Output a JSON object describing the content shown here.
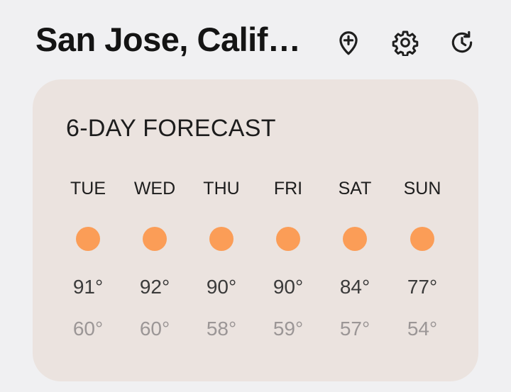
{
  "header": {
    "location": "San Jose, Calif…",
    "actions": [
      {
        "icon": "add-location-icon"
      },
      {
        "icon": "gear-icon"
      },
      {
        "icon": "history-icon"
      }
    ]
  },
  "forecast": {
    "title": "6-DAY FORECAST",
    "days": [
      {
        "name": "TUE",
        "high": "91°",
        "low": "60°",
        "icon": "sun-icon"
      },
      {
        "name": "WED",
        "high": "92°",
        "low": "60°",
        "icon": "sun-icon"
      },
      {
        "name": "THU",
        "high": "90°",
        "low": "58°",
        "icon": "sun-icon"
      },
      {
        "name": "FRI",
        "high": "90°",
        "low": "59°",
        "icon": "sun-icon"
      },
      {
        "name": "SAT",
        "high": "84°",
        "low": "57°",
        "icon": "sun-icon"
      },
      {
        "name": "SUN",
        "high": "77°",
        "low": "54°",
        "icon": "sun-icon"
      }
    ]
  },
  "colors": {
    "background": "#f0f0f2",
    "card": "#ebe3df",
    "sun": "#fb9d57",
    "low_temp": "#9b9696"
  }
}
